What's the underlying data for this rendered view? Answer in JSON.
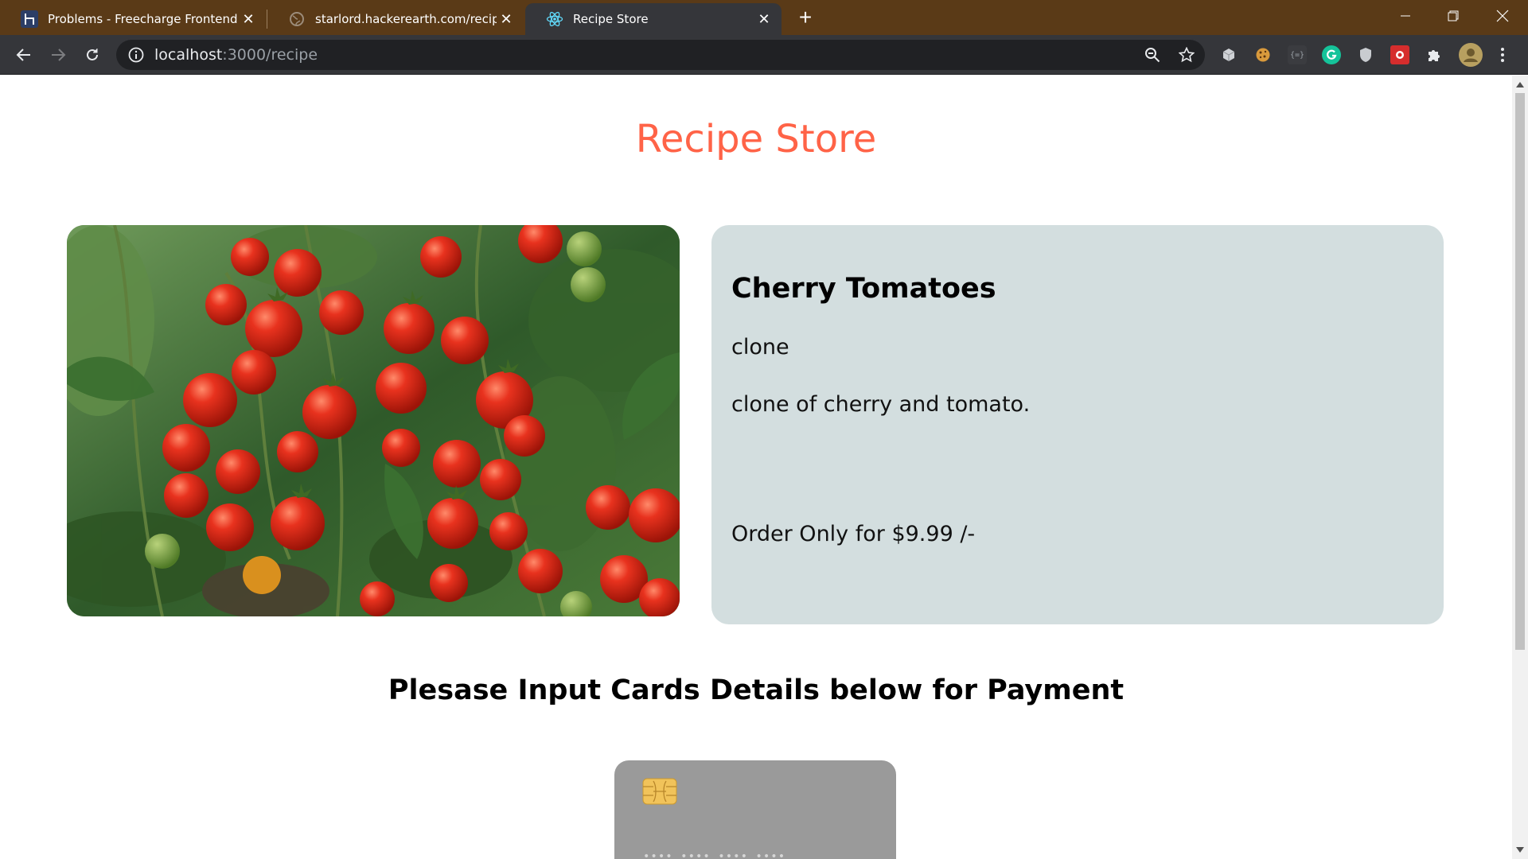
{
  "browser": {
    "tabs": [
      {
        "title": "Problems - Freecharge Frontend",
        "favicon": "hackerearth-icon",
        "active": false
      },
      {
        "title": "starlord.hackerearth.com/recipe",
        "favicon": "globe-icon",
        "active": false
      },
      {
        "title": "Recipe Store",
        "favicon": "react-icon",
        "active": true
      }
    ],
    "url_host": "localhost",
    "url_path": ":3000/recipe",
    "extensions": [
      "cube-extension-icon",
      "cookie-extension-icon",
      "json-extension-icon",
      "grammarly-extension-icon",
      "shield-extension-icon",
      "antivirus-extension-icon",
      "puzzle-extensions-icon",
      "profile-avatar"
    ]
  },
  "store": {
    "title": "Recipe Store",
    "title_color": "#ff6347"
  },
  "recipe": {
    "name": "Cherry Tomatoes",
    "category": "clone",
    "description": "clone of cherry and tomato.",
    "price_text": "Order Only for $9.99 /-",
    "image": "cherry-tomatoes-photo"
  },
  "payment": {
    "heading": "Plesase Input Cards Details below for Payment",
    "card_number_mask": "•••• •••• •••• ••••"
  }
}
